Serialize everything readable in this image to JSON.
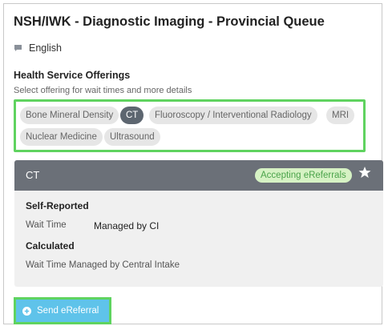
{
  "header": {
    "title": "NSH/IWK - Diagnostic Imaging - Provincial Queue"
  },
  "language": {
    "label": "English",
    "icon": "speech-bubble-icon"
  },
  "offerings": {
    "title": "Health Service Offerings",
    "subtitle": "Select offering for wait times and more details",
    "chips": [
      {
        "label": "Bone Mineral Density"
      },
      {
        "label": "CT"
      },
      {
        "label": "Fluoroscopy / Interventional Radiology"
      },
      {
        "label": "MRI"
      },
      {
        "label": "Nuclear Medicine"
      },
      {
        "label": "Ultrasound"
      }
    ],
    "selected": "CT",
    "highlight_color": "#5fd35f"
  },
  "detail": {
    "title": "CT",
    "badge": "Accepting eReferrals",
    "star_icon": "star-icon",
    "self_reported_label": "Self-Reported",
    "wait_time_label": "Wait Time",
    "wait_time_value": "Managed by CI",
    "calculated_label": "Calculated",
    "calculated_text": "Wait Time Managed by Central Intake"
  },
  "actions": {
    "send_label": "Send eReferral",
    "send_icon": "plus-circle-icon",
    "accent": "#5fc3ea"
  }
}
